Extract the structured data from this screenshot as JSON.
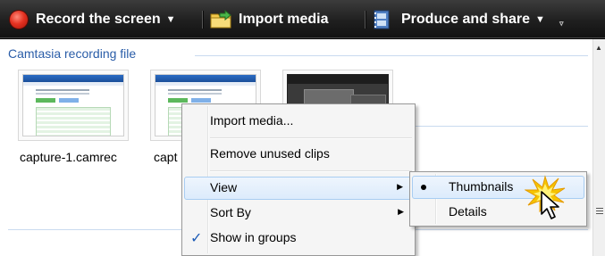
{
  "toolbar": {
    "record_label": "Record the screen",
    "import_label": "Import media",
    "produce_label": "Produce and share",
    "dropdown_glyph": "▼",
    "overflow_glyph": "▿",
    "icons": {
      "record": "record-dot-icon",
      "import": "folder-import-icon",
      "produce": "film-strip-icon"
    }
  },
  "clip_bin": {
    "group_header": "Camtasia recording file",
    "thumbnails": [
      {
        "label": "capture-1.camrec",
        "style": "web-page"
      },
      {
        "label": "capt",
        "style": "web-page"
      },
      {
        "label": "",
        "style": "dark-desktop"
      }
    ]
  },
  "context_menu": {
    "items": [
      {
        "label": "Import media...",
        "has_submenu": false,
        "checked": false
      },
      {
        "label": "Remove unused clips",
        "has_submenu": false,
        "checked": false
      },
      {
        "label": "View",
        "has_submenu": true,
        "checked": false,
        "highlighted": true
      },
      {
        "label": "Sort By",
        "has_submenu": true,
        "checked": false
      },
      {
        "label": "Show in groups",
        "has_submenu": false,
        "checked": true
      }
    ],
    "submenu_arrow": "▶",
    "check_glyph": "✓"
  },
  "view_submenu": {
    "items": [
      {
        "label": "Thumbnails",
        "selected": true,
        "highlighted": true
      },
      {
        "label": "Details",
        "selected": false
      }
    ]
  },
  "scrollbar": {
    "up_glyph": "▲"
  },
  "colors": {
    "toolbar_bg": "#1f1f1f",
    "group_header": "#2a5da8",
    "highlight_border": "#a8cdf2",
    "check": "#1c5bb6",
    "burst": "#f5c400"
  }
}
